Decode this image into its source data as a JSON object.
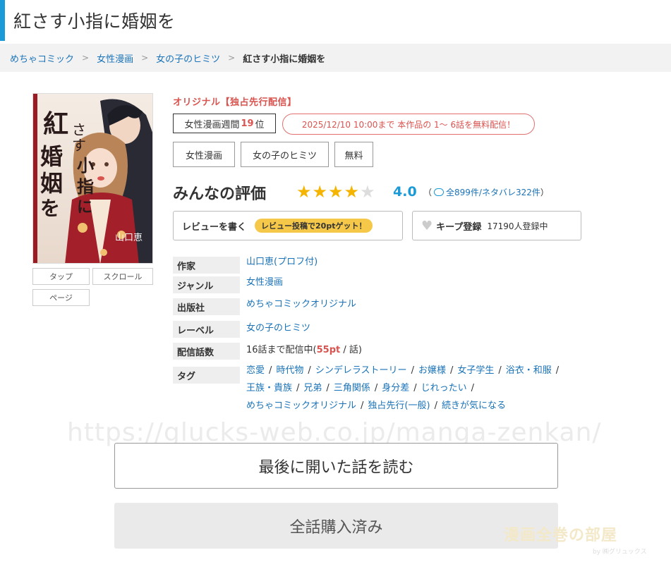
{
  "page": {
    "title": "紅さす小指に婚姻を"
  },
  "breadcrumb": {
    "items": [
      "めちゃコミック",
      "女性漫画",
      "女の子のヒミツ"
    ],
    "current": "紅さす小指に婚姻を",
    "separator": ">"
  },
  "cover": {
    "title_text": "紅さす小指に婚姻を",
    "author_text": "山口恵"
  },
  "view_buttons": [
    "タップ",
    "スクロール",
    "ページ"
  ],
  "label": "オリジナル【独占先行配信】",
  "rank": {
    "prefix": "女性漫画週間",
    "number": "19",
    "suffix": "位"
  },
  "free_notice": "2025/12/10 10:00まで 本作品の 1～ 6話を無料配信！",
  "tags_top": [
    "女性漫画",
    "女の子のヒミツ",
    "無料"
  ],
  "rating": {
    "label": "みんなの評価",
    "stars_filled": 4,
    "stars_total": 5,
    "score": "4.0",
    "count_text": "全899件/ネタバレ322件",
    "paren_open": "（",
    "paren_close": "）"
  },
  "review_button": {
    "label": "レビューを書く",
    "promo": "レビュー投稿で20ptゲット！"
  },
  "keep_button": {
    "label": "キープ登録",
    "count": "17190人登録中"
  },
  "info": {
    "author_label": "作家",
    "author_value": "山口恵(プロフ付)",
    "genre_label": "ジャンル",
    "genre_value": "女性漫画",
    "publisher_label": "出版社",
    "publisher_value": "めちゃコミックオリジナル",
    "label_label": "レーベル",
    "label_value": "女の子のヒミツ",
    "episodes_label": "配信話数",
    "episodes_prefix": "16話まで配信中(",
    "episodes_price": "55pt",
    "episodes_suffix": " / 話)",
    "tags_label": "タグ"
  },
  "tags": {
    "line1": [
      "恋愛",
      "時代物",
      "シンデレラストーリー",
      "お嬢様",
      "女子学生",
      "浴衣・和服"
    ],
    "line2": [
      "王族・貴族",
      "兄弟",
      "三角関係",
      "身分差",
      "じれったい"
    ],
    "line3": [
      "めちゃコミックオリジナル",
      "独占先行(一般)",
      "続きが気になる"
    ]
  },
  "watermark": {
    "url": "https://glucks-web.co.jp/manga-zenkan/",
    "brand": "漫画全巻の部屋",
    "brand_sub": "by ㈱グリュックス"
  },
  "actions": {
    "read_last": "最後に開いた話を読む",
    "purchased_all": "全話購入済み"
  },
  "colors": {
    "accent": "#1a9ad6",
    "link": "#1a73b8",
    "red": "#d9534f",
    "star": "#f5b400"
  }
}
